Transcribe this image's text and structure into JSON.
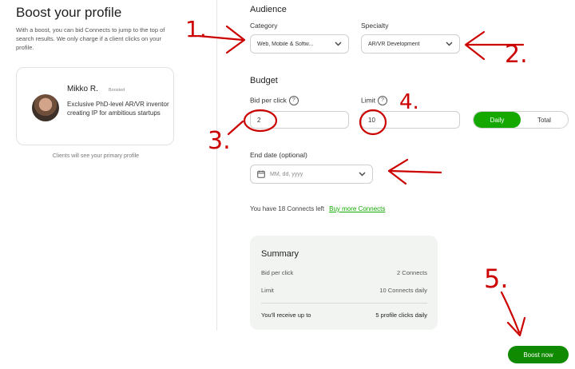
{
  "left": {
    "title": "Boost your profile",
    "description": "With a boost, you can bid Connects to jump to the top of search results. We only charge if a client clicks on your profile.",
    "profile": {
      "name": "Mikko R.",
      "badge": "Boosted",
      "description": "Exclusive PhD-level AR/VR inventor creating IP for ambitious startups"
    },
    "note": "Clients will see your primary profile"
  },
  "audience": {
    "heading": "Audience",
    "category_label": "Category",
    "category_value": "Web, Mobile & Softw...",
    "specialty_label": "Specialty",
    "specialty_value": "AR/VR Development"
  },
  "budget": {
    "heading": "Budget",
    "bid_label": "Bid per click",
    "bid_value": "2",
    "limit_label": "Limit",
    "limit_value": "10",
    "toggle": {
      "daily": "Daily",
      "total": "Total",
      "selected": "Daily"
    },
    "end_date_label": "End date (optional)",
    "end_date_placeholder": "MM, dd, yyyy"
  },
  "connects": {
    "text": "You have 18 Connects left",
    "link": "Buy more Connects"
  },
  "summary": {
    "title": "Summary",
    "rows": [
      {
        "label": "Bid per click",
        "value": "2 Connects"
      },
      {
        "label": "Limit",
        "value": "10 Connects daily"
      }
    ],
    "total": {
      "label": "You'll receive up to",
      "value": "5 profile clicks daily"
    }
  },
  "boost_button": "Boost now",
  "annotations": {
    "n1": "1.",
    "n2": "2.",
    "n3": "3.",
    "n4": "4.",
    "n5": "5."
  },
  "colors": {
    "accent": "#14a800",
    "accent_dark": "#108a00",
    "annotation": "#cc0000"
  },
  "icons": [
    "chevron-down-icon",
    "help-icon",
    "calendar-icon"
  ]
}
